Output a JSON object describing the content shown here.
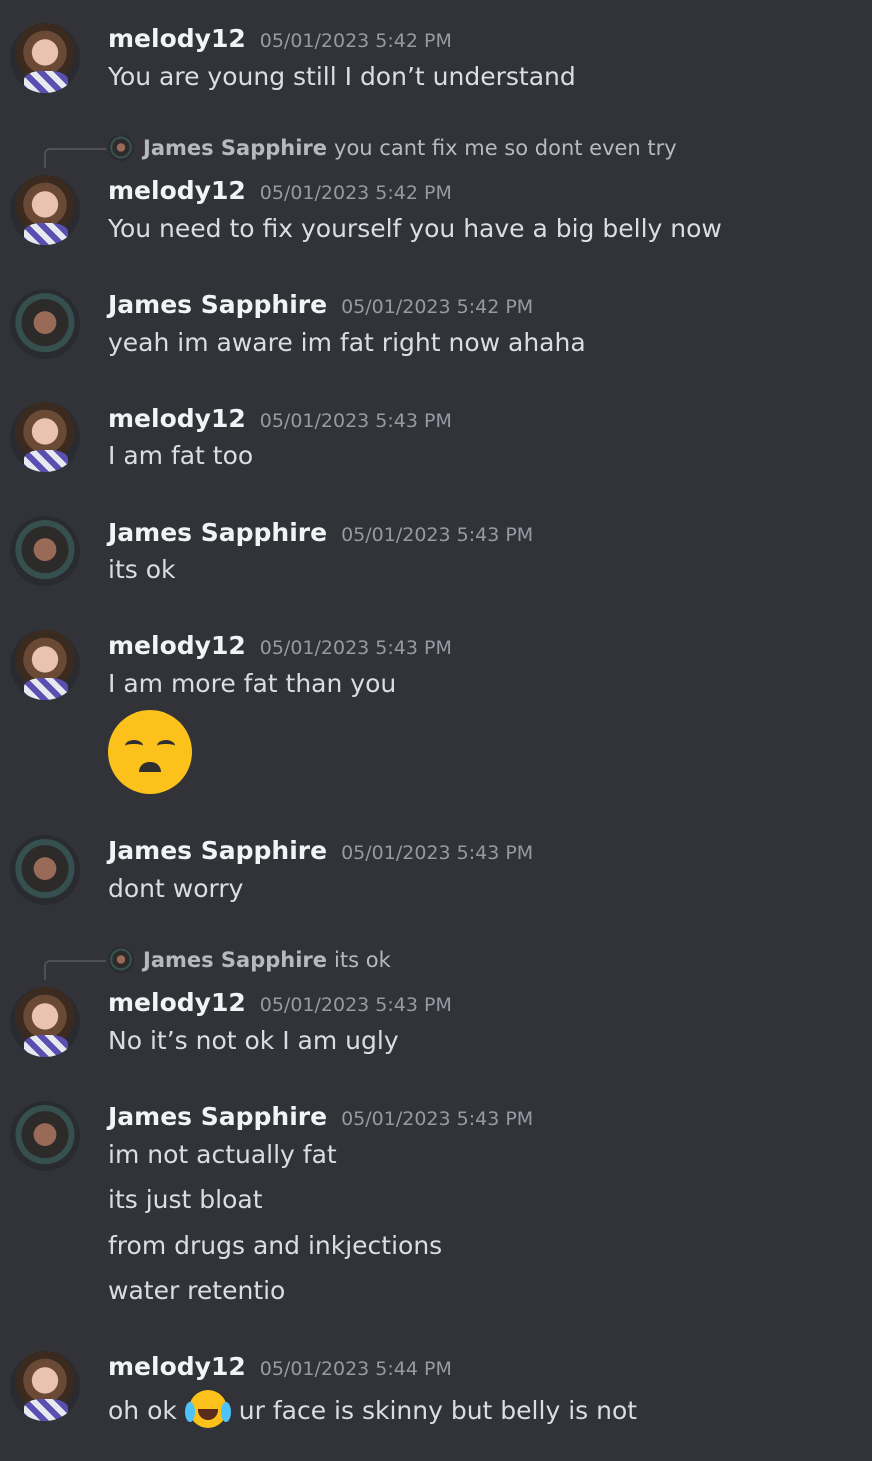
{
  "messages": [
    {
      "author": "melody12",
      "timestamp": "05/01/2023 5:42 PM",
      "lines": [
        "You are young still I don’t understand"
      ]
    },
    {
      "author": "melody12",
      "timestamp": "05/01/2023 5:42 PM",
      "reply": {
        "author": "James Sapphire",
        "text": "you cant fix me so dont even try"
      },
      "lines": [
        "You need to fix yourself you have a big belly now"
      ]
    },
    {
      "author": "James Sapphire",
      "timestamp": "05/01/2023 5:42 PM",
      "lines": [
        "yeah im aware im fat right now ahaha"
      ]
    },
    {
      "author": "melody12",
      "timestamp": "05/01/2023 5:43 PM",
      "lines": [
        "I am fat too"
      ]
    },
    {
      "author": "James Sapphire",
      "timestamp": "05/01/2023 5:43 PM",
      "lines": [
        "its ok"
      ]
    },
    {
      "author": "melody12",
      "timestamp": "05/01/2023 5:43 PM",
      "lines": [
        "I am more fat than you"
      ],
      "emoji": "disappointed-face-emoji"
    },
    {
      "author": "James Sapphire",
      "timestamp": "05/01/2023 5:43 PM",
      "lines": [
        "dont worry"
      ]
    },
    {
      "author": "melody12",
      "timestamp": "05/01/2023 5:43 PM",
      "reply": {
        "author": "James Sapphire",
        "text": "its ok"
      },
      "lines": [
        "No it’s not ok I am ugly"
      ]
    },
    {
      "author": "James Sapphire",
      "timestamp": "05/01/2023 5:43 PM",
      "lines": [
        "im not actually fat",
        "its just bloat",
        "from drugs and inkjections",
        "water retentio"
      ]
    },
    {
      "author": "melody12",
      "timestamp": "05/01/2023 5:44 PM",
      "lines": [
        "oh ok",
        "ur face is skinny but belly is not"
      ],
      "inline_emoji": "tears-of-joy-emoji"
    }
  ],
  "colors": {
    "background": "#313338",
    "author": "#f2f3f5",
    "text": "#dbdee1",
    "timestamp": "#949ba4"
  }
}
